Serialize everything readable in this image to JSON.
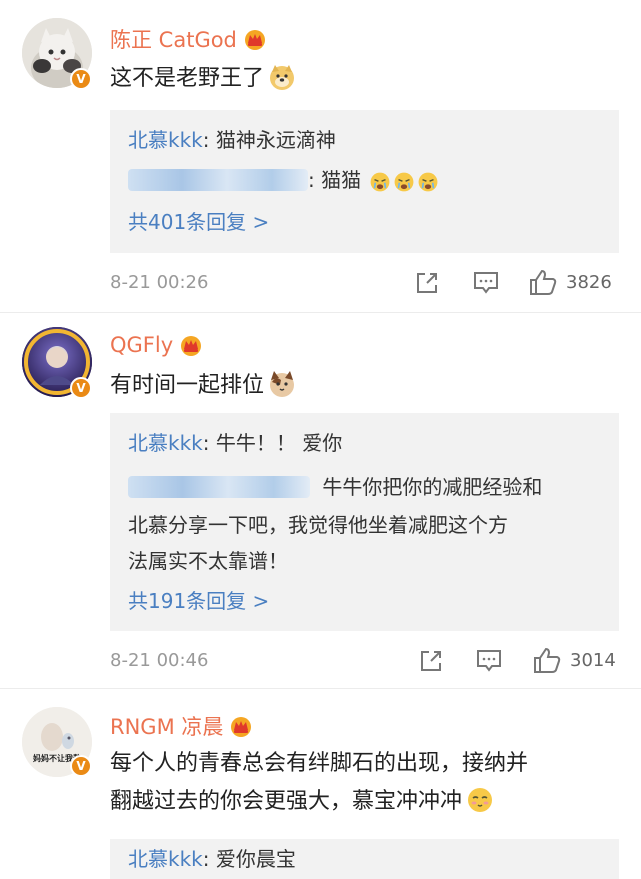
{
  "comments": [
    {
      "username": "陈正 CatGod",
      "text": "这不是老野王了",
      "replies": [
        {
          "name": "北慕kkk",
          "text": ": 猫神永远滴神"
        },
        {
          "name": "",
          "text": ": 猫猫"
        }
      ],
      "more_replies": "共401条回复 >",
      "timestamp": "8-21 00:26",
      "like_count": "3826",
      "avatar_label": ""
    },
    {
      "username": "QGFly",
      "text": "有时间一起排位",
      "replies": [
        {
          "name": "北慕kkk",
          "text": ": 牛牛！！ 爱你"
        },
        {
          "name": "",
          "text": "牛牛你把你的减肥经验和"
        }
      ],
      "reply_continuation": [
        "北慕分享一下吧，我觉得他坐着减肥这个方",
        "法属实不太靠谱！"
      ],
      "more_replies": "共191条回复 >",
      "timestamp": "8-21 00:46",
      "like_count": "3014",
      "avatar_label": ""
    },
    {
      "username": "RNGM 凉晨",
      "text_lines": [
        "每个人的青春总会有绊脚石的出现，接纳并",
        "翻越过去的你会更强大，慕宝冲冲冲"
      ],
      "replies": [
        {
          "name": "北慕kkk",
          "text": ": 爱你晨宝"
        }
      ],
      "avatar_label": "妈妈不让我熬"
    }
  ],
  "colors": {
    "username": "#eb7350",
    "reply_name": "#4a7fc1",
    "reply_bg": "#f2f2f2",
    "meta": "#999999",
    "verified_badge": "#ea8a15"
  },
  "icons": {
    "share": "share-icon",
    "comment": "comment-icon",
    "like": "thumbs-up-icon",
    "verified": "verified-badge-icon",
    "crown": "crown-icon"
  }
}
